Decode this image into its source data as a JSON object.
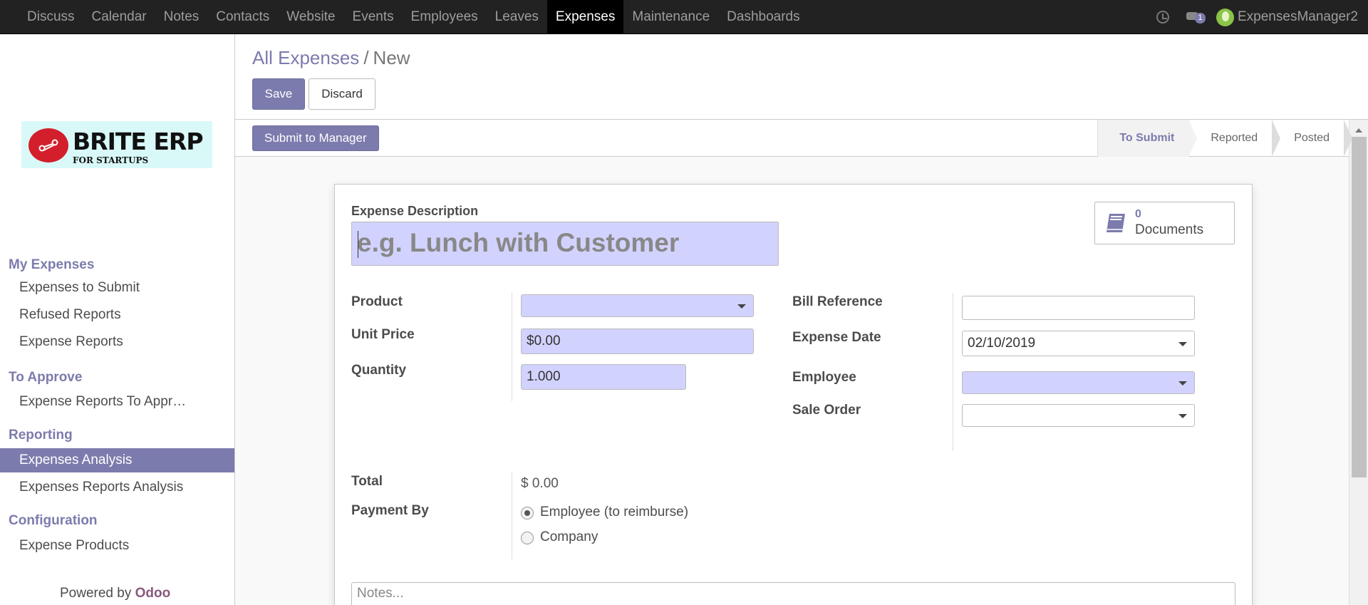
{
  "nav": {
    "items": [
      "Discuss",
      "Calendar",
      "Notes",
      "Contacts",
      "Website",
      "Events",
      "Employees",
      "Leaves",
      "Expenses",
      "Maintenance",
      "Dashboards"
    ],
    "active": "Expenses",
    "message_count": "1",
    "username": "ExpensesManager2"
  },
  "logo": {
    "brand": "BRITE ERP",
    "tagline": "FOR STARTUPS"
  },
  "sidebar": {
    "sections": [
      {
        "title": "My Expenses",
        "items": [
          "Expenses to Submit",
          "Refused Reports",
          "Expense Reports"
        ]
      },
      {
        "title": "To Approve",
        "items": [
          "Expense Reports To Appr…"
        ]
      },
      {
        "title": "Reporting",
        "items": [
          "Expenses Analysis",
          "Expenses Reports Analysis"
        ]
      },
      {
        "title": "Configuration",
        "items": [
          "Expense Products"
        ]
      }
    ],
    "active_item": "Expenses Analysis",
    "powered_by": "Powered by",
    "powered_brand": "Odoo"
  },
  "breadcrumb": {
    "parent": "All Expenses",
    "separator": "/",
    "current": "New"
  },
  "buttons": {
    "save": "Save",
    "discard": "Discard",
    "submit": "Submit to Manager"
  },
  "stages": [
    "To Submit",
    "Reported",
    "Posted"
  ],
  "active_stage": "To Submit",
  "form": {
    "description_label": "Expense Description",
    "description_placeholder": "e.g. Lunch with Customer",
    "documents_count": "0",
    "documents_label": "Documents",
    "product_label": "Product",
    "product_value": "",
    "unit_price_label": "Unit Price",
    "unit_price_value": "$0.00",
    "quantity_label": "Quantity",
    "quantity_value": "1.000",
    "bill_reference_label": "Bill Reference",
    "bill_reference_value": "",
    "expense_date_label": "Expense Date",
    "expense_date_value": "02/10/2019",
    "employee_label": "Employee",
    "employee_value": "",
    "sale_order_label": "Sale Order",
    "sale_order_value": "",
    "total_label": "Total",
    "total_value": "$ 0.00",
    "payment_by_label": "Payment By",
    "payment_options": [
      "Employee (to reimburse)",
      "Company"
    ],
    "payment_selected": "Employee (to reimburse)",
    "notes_placeholder": "Notes..."
  },
  "colors": {
    "primary": "#7c7bad",
    "required_field": "#d2d2ff",
    "navbar": "#222222"
  }
}
